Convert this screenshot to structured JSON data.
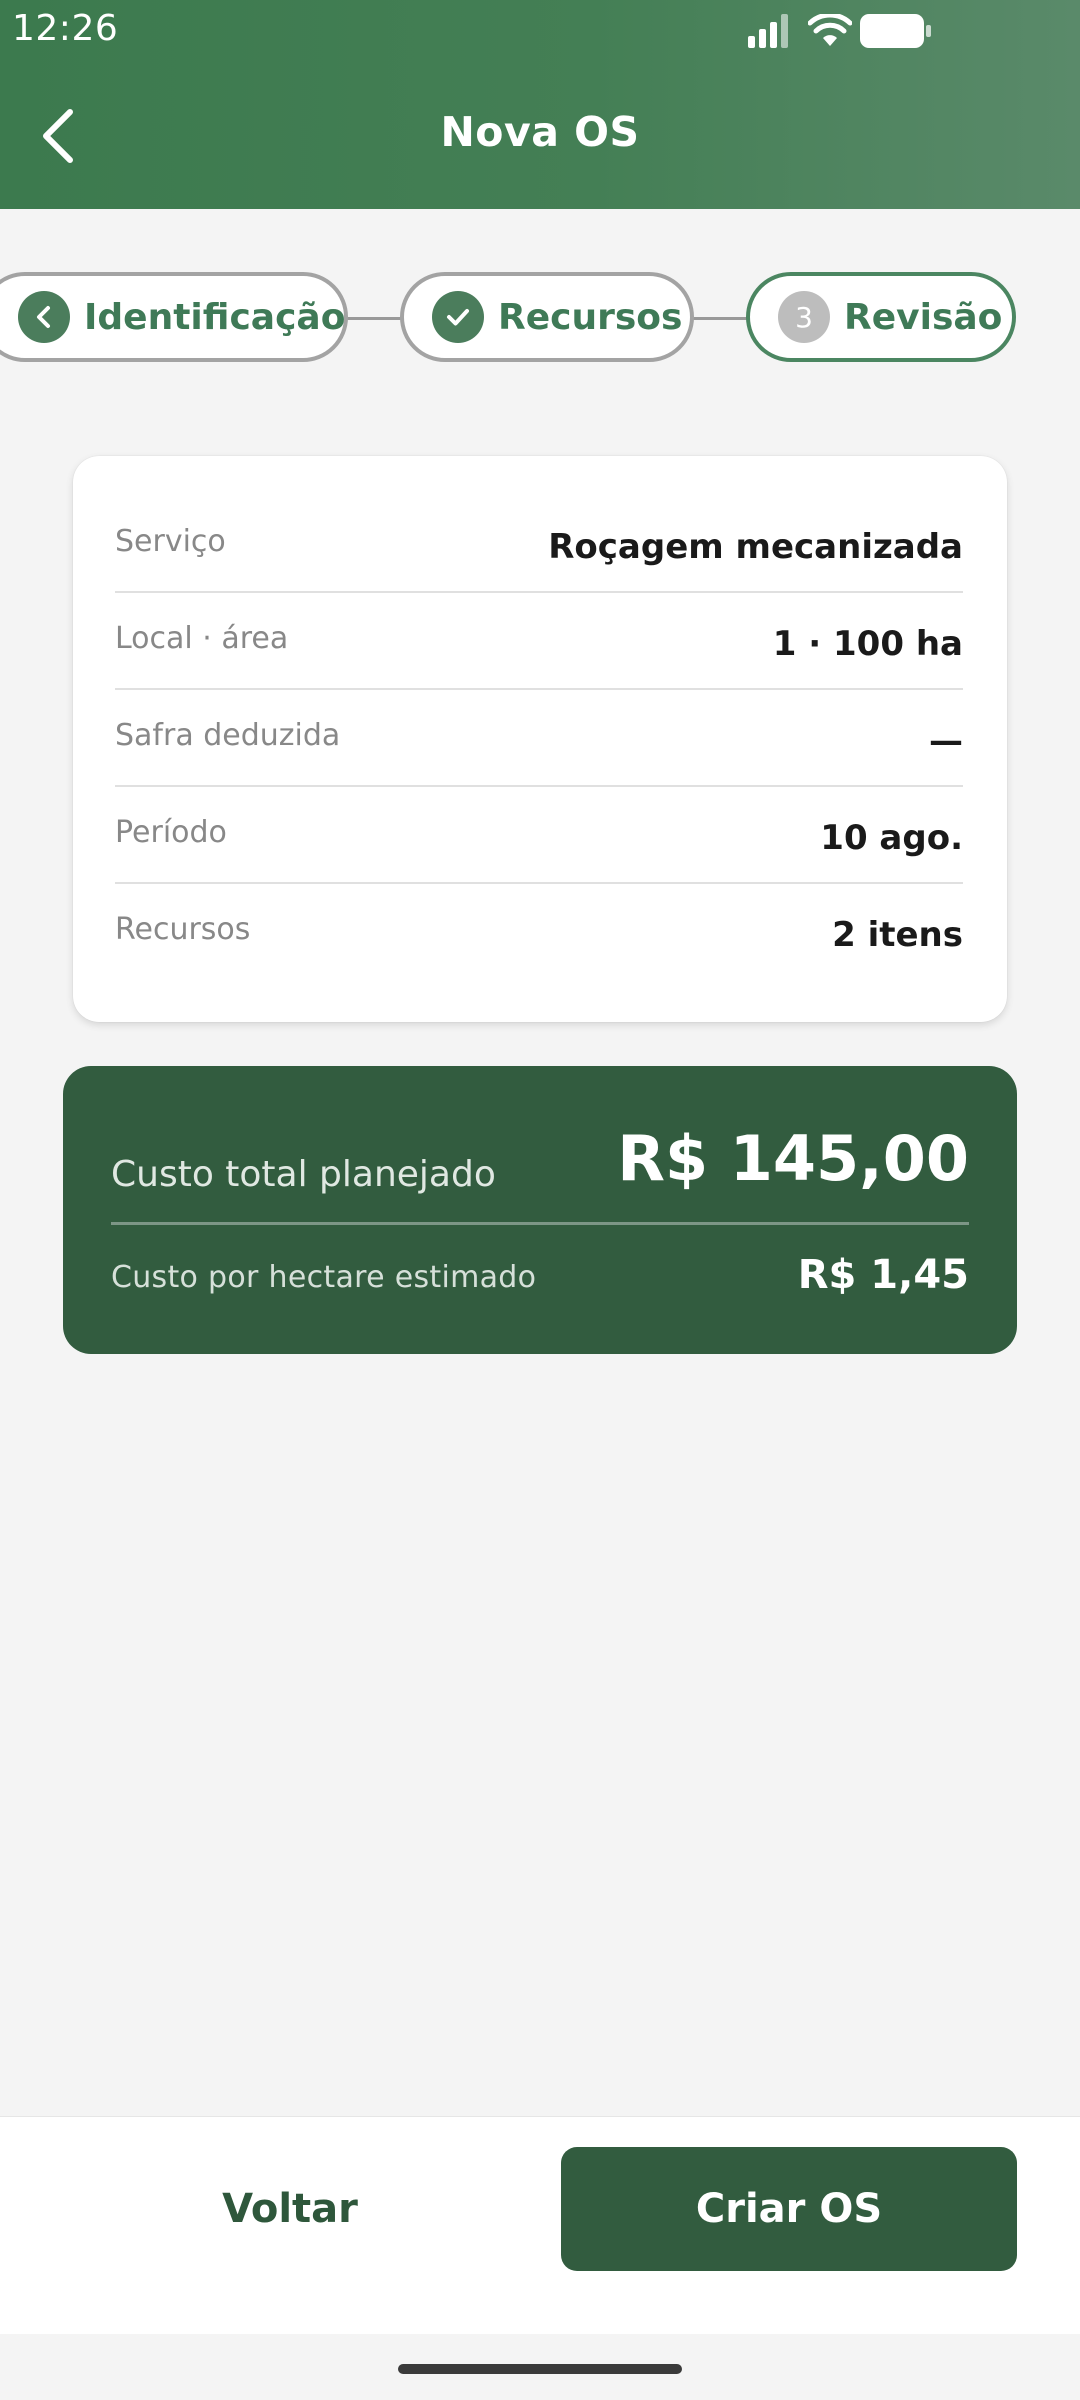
{
  "status_bar": {
    "time": "12:26"
  },
  "header": {
    "title": "Nova OS"
  },
  "stepper": {
    "steps": [
      {
        "label": "Identificação",
        "state": "done"
      },
      {
        "label": "Recursos",
        "state": "done"
      },
      {
        "label": "Revisão",
        "state": "active",
        "number": "3"
      }
    ]
  },
  "summary": {
    "rows": [
      {
        "label": "Serviço",
        "value": "Roçagem mecanizada"
      },
      {
        "label": "Local · área",
        "value": "1 · 100 ha"
      },
      {
        "label": "Safra deduzida",
        "value": "—"
      },
      {
        "label": "Período",
        "value": "10 ago."
      },
      {
        "label": "Recursos",
        "value": "2 itens"
      }
    ]
  },
  "cost": {
    "total_label": "Custo total planejado",
    "total_value": "R$ 145,00",
    "per_ha_label": "Custo por hectare estimado",
    "per_ha_value": "R$ 1,45"
  },
  "actions": {
    "back_label": "Voltar",
    "create_label": "Criar OS"
  },
  "colors": {
    "primary": "#325c3f",
    "header": "#447f55",
    "accent_text": "#3f7a57",
    "background": "#f4f4f4"
  }
}
